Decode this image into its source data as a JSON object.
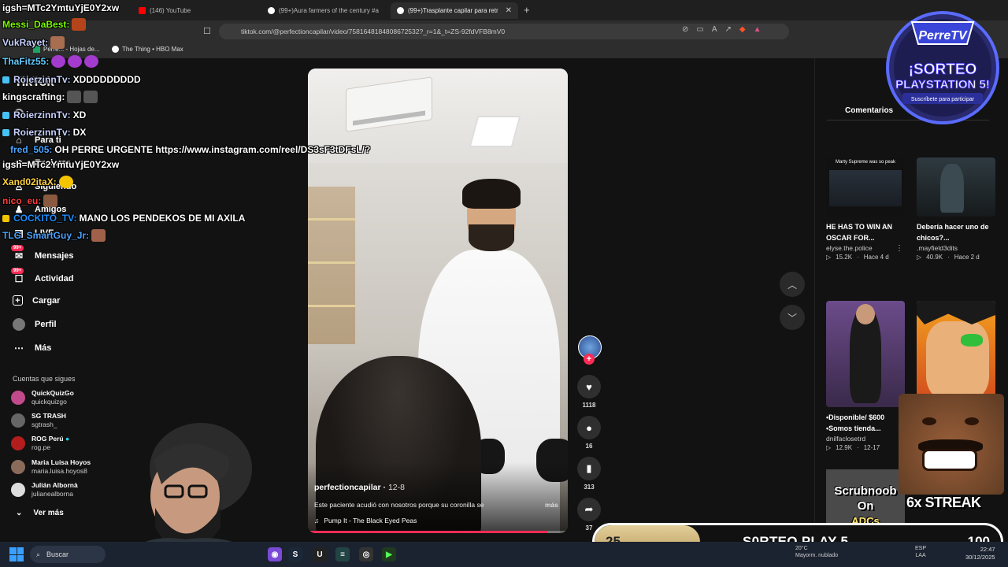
{
  "browser": {
    "tabs": [
      {
        "label": "(146) YouTube",
        "icon": "youtube-icon",
        "color": "#ff0000"
      },
      {
        "label": "(99+)Aura farmers of the century #a",
        "icon": "tiktok-icon",
        "color": "#ffffff"
      },
      {
        "label": "(99+)Trasplante capilar para retr",
        "icon": "tiktok-icon",
        "color": "#ffffff"
      }
    ],
    "url": "tiktok.com/@perfectioncapilar/video/7581648184808672532?_r=1&_t=ZS-92fdVFB8mV0",
    "bookmarks": [
      {
        "label": "Perre... - Hojas de...",
        "icon": "sheets-icon"
      },
      {
        "label": "The Thing • HBO Max",
        "icon": "hbo-icon"
      }
    ]
  },
  "sidebar": {
    "logo": "TikTok",
    "items": [
      {
        "label": "Para ti",
        "icon": "home-icon"
      },
      {
        "label": "Explorar",
        "icon": "compass-icon"
      },
      {
        "label": "Siguiendo",
        "icon": "following-icon"
      },
      {
        "label": "Amigos",
        "icon": "friends-icon"
      },
      {
        "label": "LIVE",
        "icon": "live-icon"
      },
      {
        "label": "Mensajes",
        "icon": "message-icon",
        "badge": "99+"
      },
      {
        "label": "Actividad",
        "icon": "activity-icon",
        "badge": "99+"
      },
      {
        "label": "Cargar",
        "icon": "upload-icon"
      },
      {
        "label": "Perfil",
        "icon": "profile-icon"
      },
      {
        "label": "Más",
        "icon": "more-icon"
      }
    ],
    "following_title": "Cuentas que sigues",
    "following": [
      {
        "name": "QuickQuizGo",
        "handle": "quickquizgo"
      },
      {
        "name": "SG TRASH",
        "handle": "sgtrash_"
      },
      {
        "name": "ROG Perú",
        "handle": "rog.pe",
        "verified": true
      },
      {
        "name": "Maria Luisa Hoyos",
        "handle": "maria.luisa.hoyos8"
      },
      {
        "name": "Julián Albornà",
        "handle": "julianealborna"
      }
    ],
    "see_more": "Ver más"
  },
  "video": {
    "author": "perfectioncapilar",
    "date": "12-8",
    "caption": "Este paciente acudió con nosotros porque su coronilla se",
    "more": "más",
    "music": "Pump It - The Black Eyed Peas",
    "progress": 0.92
  },
  "actions": {
    "likes": "1118",
    "comments": "16",
    "saves": "313",
    "shares": "37"
  },
  "right_panel": {
    "tab": "Comentarios",
    "cards": [
      {
        "title": "HE HAS TO WIN AN OSCAR FOR...",
        "author": "elyse.the.police",
        "views": "15.2K",
        "time": "Hace 4 d",
        "thumb_text": "Marty Supreme was so peak"
      },
      {
        "title": "Debería hacer uno de chicos?...",
        "author": ".mayfield3dits",
        "views": "40.9K",
        "time": "Hace 2 d",
        "thumb_text": ""
      },
      {
        "title": "•Disponible/ $600 •Somos tienda...",
        "author": "dnilfaclosetrd",
        "views": "12.9K",
        "time": "12-17",
        "thumb_text": ""
      }
    ]
  },
  "stream": {
    "chat": [
      {
        "user": "igsh=MTc2YmtuYjE0Y2xw",
        "message": "",
        "color": "#ffffff"
      },
      {
        "user": "Messi_DaBest:",
        "message": "",
        "color": "#7cfc00"
      },
      {
        "user": "VukRayet:",
        "message": "",
        "color": "#c7d2ff"
      },
      {
        "user": "ThaFitz55:",
        "message": "",
        "color": "#66ccff"
      },
      {
        "user": "RoierzinnTv:",
        "message": "XDDDDDDDDD",
        "color": "#c7d2ff"
      },
      {
        "user": "kingscrafting:",
        "message": "",
        "color": "#ffffff"
      },
      {
        "user": "RoierzinnTv:",
        "message": "XD",
        "color": "#c7d2ff"
      },
      {
        "user": "RoierzinnTv:",
        "message": "DX",
        "color": "#c7d2ff"
      },
      {
        "user": "fred_505:",
        "message": "OH PERRE URGENTE https://www.instagram.com/reel/DS3sF3tDFsL/?",
        "color": "#4aa3ff"
      },
      {
        "user": "igsh=MTc2YmtuYjE0Y2xw",
        "message": "",
        "color": "#ffffff"
      },
      {
        "user": "Xand02itaX:",
        "message": "",
        "color": "#ffd23f"
      },
      {
        "user": "nico_eu:",
        "message": "",
        "color": "#ff3b3b"
      },
      {
        "user": "COCKITO_TV:",
        "message": "MANO LOS PENDEKOS DE MI AXILA",
        "color": "#1e90ff"
      },
      {
        "user": "TLG_SmartGuy_Jr:",
        "message": "",
        "color": "#4aa3ff"
      }
    ],
    "logo_title": "PerreTV",
    "logo_line1": "¡SORTEO",
    "logo_line2": "PLAYSTATION 5!",
    "logo_sub": "Suscríbete para participar",
    "streak": "6x STREAK",
    "scrub_lines": [
      "Scrubnoob",
      "On",
      "ADCs"
    ],
    "sorteo_current": "25",
    "sorteo_label": "S0RTEO PLAY 5",
    "sorteo_max": "100",
    "sorteo_fraction": 0.25
  },
  "taskbar": {
    "search": "Buscar",
    "temp": "20°C",
    "weather": "Mayorm. nublado",
    "lang1": "ESP",
    "lang2": "LAA",
    "time": "22:47",
    "date": "30/12/2025"
  }
}
